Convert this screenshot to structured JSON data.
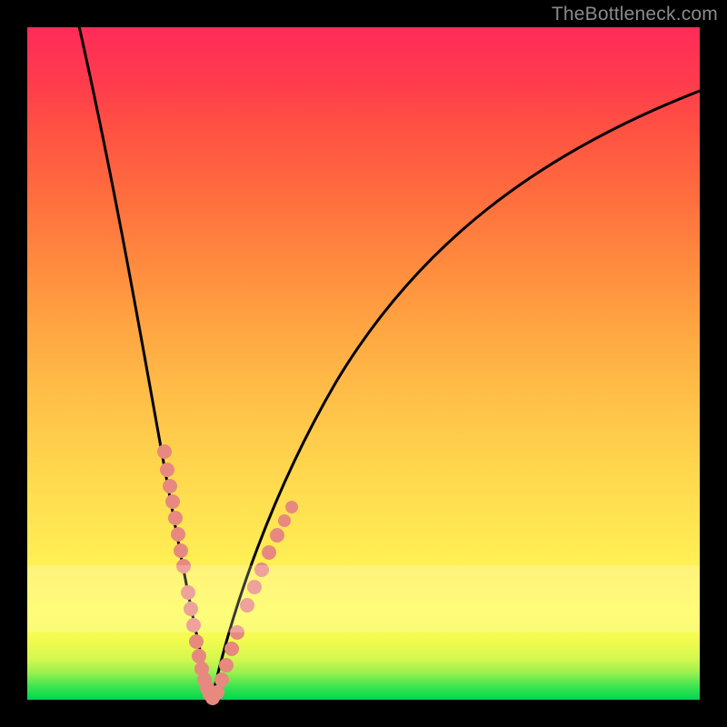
{
  "watermark": "TheBottleneck.com",
  "colors": {
    "curve": "#000000",
    "dots": "#e8897f",
    "frame": "#000000",
    "gradient_top": "#ff2b58",
    "gradient_bottom": "#01d64f"
  },
  "chart_data": {
    "type": "line",
    "title": "",
    "xlabel": "",
    "ylabel": "",
    "xlim": [
      0,
      100
    ],
    "ylim": [
      0,
      100
    ],
    "series": [
      {
        "name": "left-curve",
        "x": [
          7,
          8,
          9,
          10,
          11,
          12,
          13,
          14,
          15,
          16,
          17,
          18,
          19,
          20,
          21,
          22,
          23,
          24,
          25,
          26,
          27
        ],
        "values": [
          100,
          95,
          90,
          85,
          79,
          73,
          67,
          60,
          53,
          46,
          40,
          33,
          27,
          21,
          16,
          11,
          7,
          4,
          2,
          1,
          0
        ]
      },
      {
        "name": "right-curve",
        "x": [
          27,
          28,
          29,
          30,
          31,
          33,
          35,
          38,
          41,
          45,
          50,
          55,
          60,
          66,
          72,
          78,
          84,
          90,
          96,
          100
        ],
        "values": [
          0,
          1,
          3,
          5,
          8,
          13,
          19,
          26,
          33,
          41,
          49,
          56,
          63,
          69,
          74,
          79,
          83,
          86,
          89,
          91
        ]
      }
    ],
    "scatter": [
      {
        "segment": "left-upper",
        "approx_x_range": [
          18,
          21
        ],
        "approx_y_range": [
          22,
          38
        ],
        "count": 8
      },
      {
        "segment": "left-lower",
        "approx_x_range": [
          22,
          27
        ],
        "approx_y_range": [
          0,
          14
        ],
        "count": 10
      },
      {
        "segment": "right-lower",
        "approx_x_range": [
          27,
          31
        ],
        "approx_y_range": [
          0,
          10
        ],
        "count": 5
      },
      {
        "segment": "right-upper",
        "approx_x_range": [
          32,
          37
        ],
        "approx_y_range": [
          12,
          26
        ],
        "count": 7
      }
    ],
    "notes": "Two black curves descend from upper edges into a sharp V meeting near x≈27 at y≈0 on a vertical red→green gradient. Salmon dots cluster along the lower portions of both branches. Axes have no tick labels; values are estimated on a 0–100 normalized scale."
  }
}
